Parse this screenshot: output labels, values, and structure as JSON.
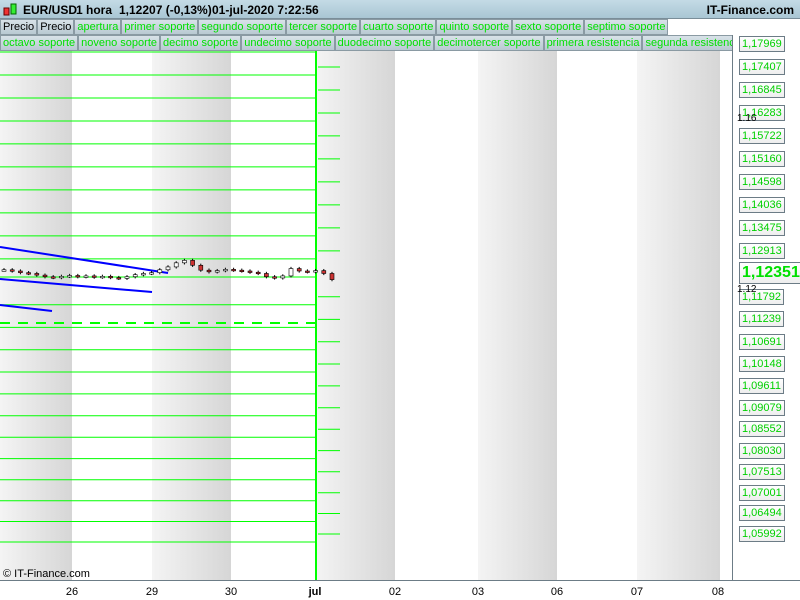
{
  "header": {
    "symbol": "EUR/USD",
    "interval": "1 hora",
    "last": "1,12207 (-0,13%)",
    "datetime": "01-jul-2020 7:22:56",
    "brand": "IT-Finance.com"
  },
  "tabs_row1": [
    "Precio",
    "Precio",
    "apertura",
    "primer soporte",
    "segundo soporte",
    "tercer soporte",
    "cuarto soporte",
    "quinto soporte",
    "sexto soporte",
    "septimo soporte"
  ],
  "tabs_row2": [
    "octavo soporte",
    "noveno soporte",
    "decimo soporte",
    "undecimo soporte",
    "duodecimo soporte",
    "decimotercer soporte",
    "primera resistencia",
    "segunda resistencia"
  ],
  "colors": {
    "level": "#00ff00",
    "trend": "#0000ff",
    "header": "#b5cfdc"
  },
  "price_axis": {
    "current": "1,12351",
    "levels": [
      "1,17969",
      "1,17407",
      "1,16845",
      "1,16283",
      "1,15722",
      "1,15160",
      "1,14598",
      "1,14036",
      "1,13475",
      "1,12913",
      "1,11792",
      "1,11239",
      "1,10691",
      "1,10148",
      "1,09611",
      "1,09079",
      "1,08552",
      "1,08030",
      "1,07513",
      "1,07001",
      "1,06494",
      "1,05992"
    ],
    "grid_labels": [
      "1.16",
      "1.12"
    ]
  },
  "date_axis": [
    "26",
    "29",
    "30",
    "jul",
    "02",
    "03",
    "06",
    "07",
    "08"
  ],
  "copyright": "© IT-Finance.com",
  "chart_data": {
    "type": "candlestick",
    "closes": [
      1.1245,
      1.1242,
      1.1238,
      1.1236,
      1.1232,
      1.1228,
      1.1226,
      1.1229,
      1.1231,
      1.1228,
      1.123,
      1.1227,
      1.1229,
      1.1226,
      1.1224,
      1.1228,
      1.1233,
      1.1236,
      1.1238,
      1.1245,
      1.1252,
      1.1262,
      1.1268,
      1.1256,
      1.1244,
      1.124,
      1.1243,
      1.1246,
      1.1244,
      1.1242,
      1.1239,
      1.1236,
      1.1228,
      1.1225,
      1.123,
      1.1248,
      1.1242,
      1.124,
      1.1243,
      1.1236,
      1.1221
    ]
  }
}
